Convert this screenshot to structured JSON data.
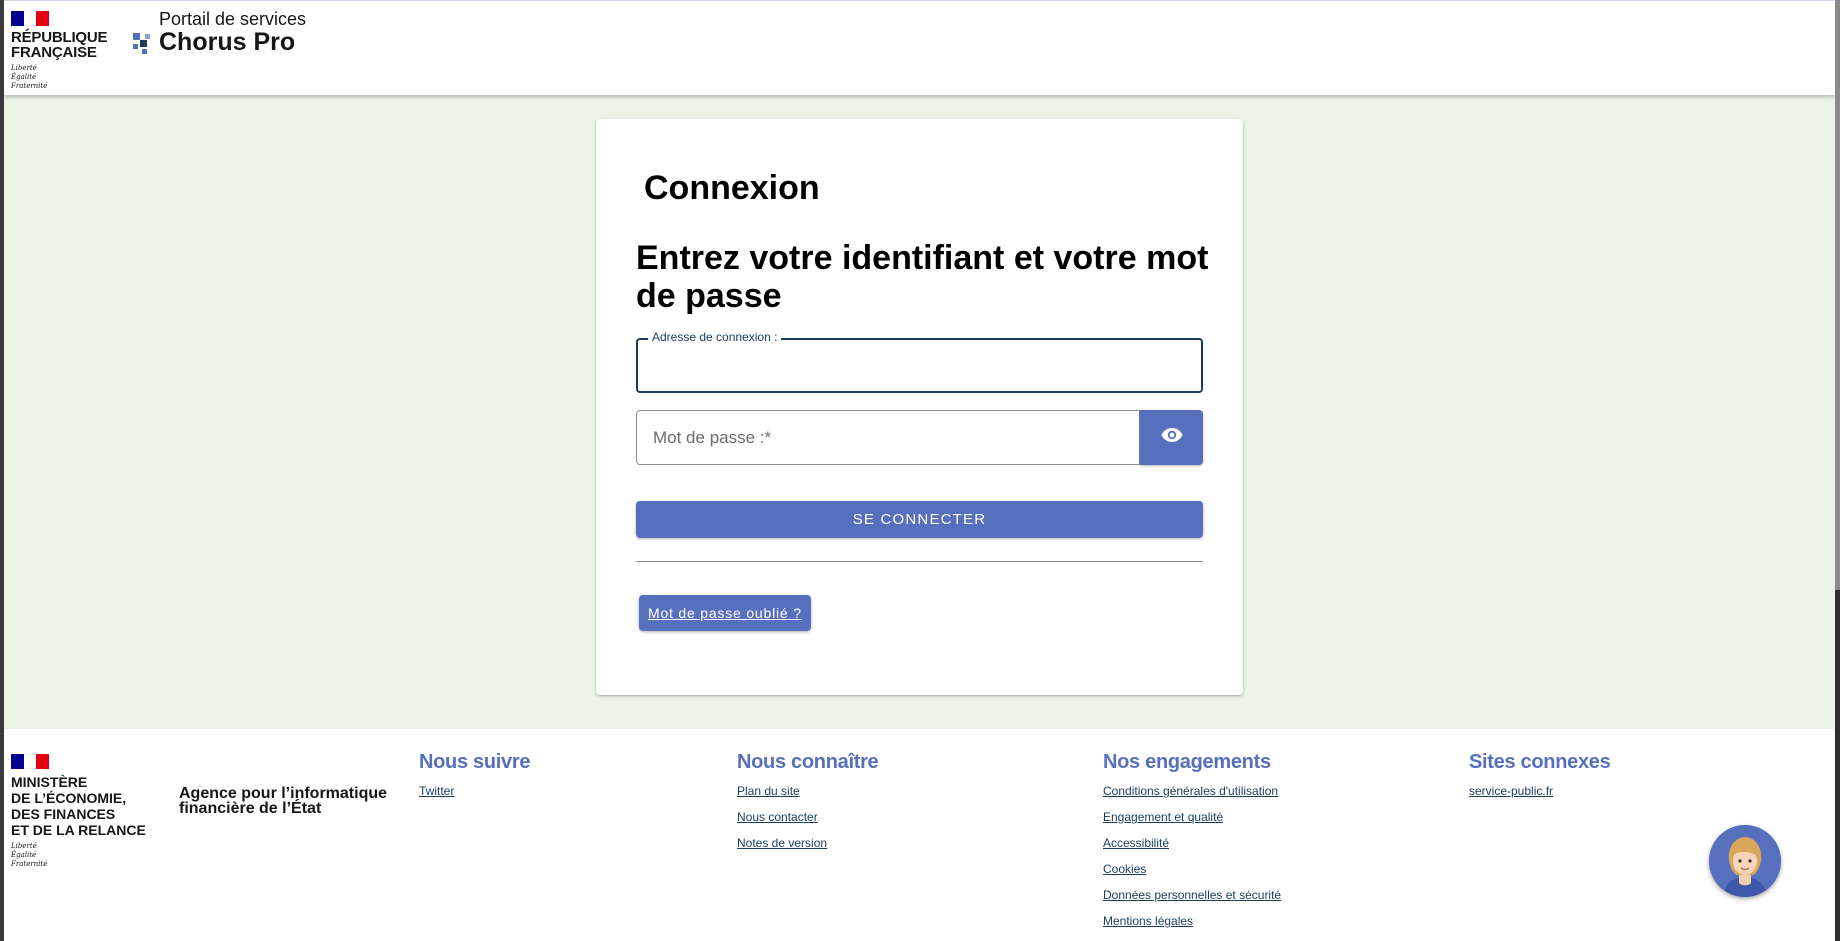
{
  "header": {
    "republique": [
      "RÉPUBLIQUE",
      "FRANÇAISE"
    ],
    "devise": [
      "Liberté",
      "Égalité",
      "Fraternité"
    ],
    "portail_subtitle": "Portail de services",
    "brand": "Chorus Pro"
  },
  "login": {
    "title": "Connexion",
    "heading": "Entrez votre identifiant et votre mot de passe",
    "email_label": "Adresse de connexion :",
    "email_value": "",
    "password_placeholder": "Mot de passe :*",
    "show_password_icon": "eye-icon",
    "submit_label": "SE CONNECTER",
    "forgot_label": "Mot de passe oublié ?"
  },
  "footer": {
    "ministere": [
      "MINISTÈRE",
      "DE L’ÉCONOMIE,",
      "DES FINANCES",
      "ET DE LA RELANCE"
    ],
    "devise": [
      "Liberté",
      "Égalité",
      "Fraternité"
    ],
    "agence": [
      "Agence pour l’informatique",
      "financière de l’État"
    ],
    "columns": [
      {
        "title": "Nous suivre",
        "links": [
          "Twitter"
        ]
      },
      {
        "title": "Nous connaître",
        "links": [
          "Plan du site",
          "Nous contacter",
          "Notes de version"
        ]
      },
      {
        "title": "Nos engagements",
        "links": [
          "Conditions générales d'utilisation",
          "Engagement et qualité",
          "Accessibilité",
          "Cookies",
          "Données personnelles et sécurité",
          "Mentions légales"
        ]
      },
      {
        "title": "Sites connexes",
        "links": [
          "service-public.fr"
        ]
      }
    ]
  },
  "colors": {
    "accent": "#5770be",
    "background": "#ebf5e6",
    "link": "#1a3d5c"
  }
}
